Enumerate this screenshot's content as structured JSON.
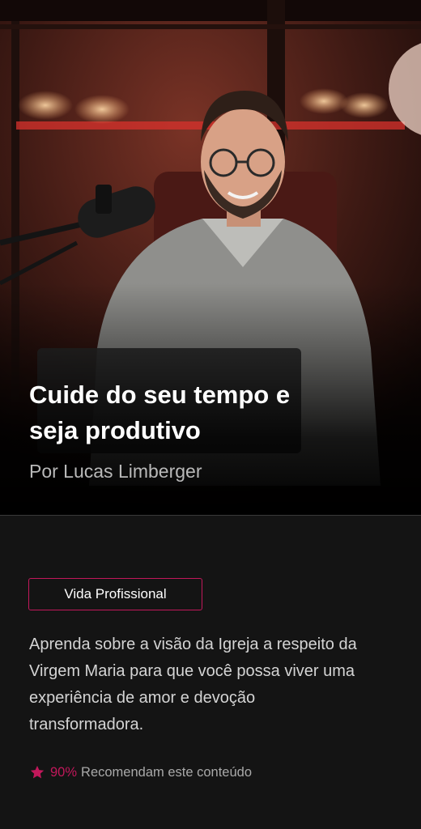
{
  "hero": {
    "title": "Cuide do seu tempo e seja produtivo",
    "author": "Por Lucas Limberger",
    "image_description": "photo-of-presenter-at-microphone"
  },
  "content": {
    "tag_label": "Vida Profissional",
    "description": "Aprenda sobre a visão da Igreja a respeito da Virgem Maria para que você possa viver uma experiência de amor e devoção transformadora.",
    "rating": {
      "percent": "90%",
      "text": "Recomendam este conteúdo",
      "icon": "star-icon"
    }
  },
  "colors": {
    "accent": "#c2185b",
    "background": "#141414",
    "hero_background": "#1a0d0b"
  }
}
